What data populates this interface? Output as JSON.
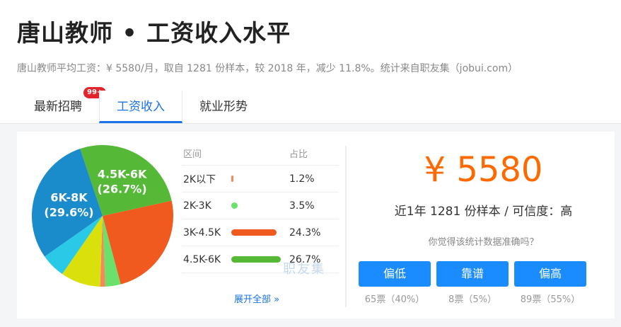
{
  "page": {
    "title": "唐山教师 • 工资收入水平",
    "subtitle": "唐山教师平均工资：¥ 5580/月，取自 1281 份样本，较 2018 年，减少 11.8%。统计来自职友集（jobui.com）"
  },
  "tabs": [
    {
      "label": "最新招聘",
      "badge": "99+"
    },
    {
      "label": "工资收入"
    },
    {
      "label": "就业形势"
    }
  ],
  "chart_data": {
    "type": "pie",
    "slices": [
      {
        "label": "2K以下",
        "value": 1.2,
        "color": "#f28a5c"
      },
      {
        "label": "2K-3K",
        "value": 3.5,
        "color": "#6be06b"
      },
      {
        "label": "3K-4.5K",
        "value": 24.3,
        "color": "#f05a1e"
      },
      {
        "label": "4.5K-6K",
        "value": 26.7,
        "color": "#55b837"
      },
      {
        "label": "6K-8K",
        "value": 29.6,
        "color": "#1a8ccc"
      },
      {
        "value": 5.6,
        "color": "#2ac9e8"
      },
      {
        "value": 9.1,
        "color": "#d9e00b"
      }
    ],
    "annotations": [
      {
        "range": "6K-8K",
        "percent": "(29.6%)"
      },
      {
        "range": "4.5K-6K",
        "percent": "(26.7%)"
      }
    ]
  },
  "table": {
    "header_range": "区间",
    "header_share": "占比",
    "rows": [
      {
        "range": "2K以下",
        "share": "1.2%",
        "color": "#f28a5c",
        "value": 1.2
      },
      {
        "range": "2K-3K",
        "share": "3.5%",
        "color": "#6be06b",
        "value": 3.5
      },
      {
        "range": "3K-4.5K",
        "share": "24.3%",
        "color": "#f05a1e",
        "value": 24.3
      },
      {
        "range": "4.5K-6K",
        "share": "26.7%",
        "color": "#55b837",
        "value": 26.7
      }
    ],
    "expand_label": "展开全部 »"
  },
  "watermark": "职友集",
  "stats": {
    "salary": "¥ 5580",
    "samples": "近1年 1281 份样本 / 可信度：高",
    "question": "你觉得该统计数据准确吗？"
  },
  "votes": [
    {
      "label": "偏低",
      "count": "65票（40%）"
    },
    {
      "label": "靠谱",
      "count": "8票（5%）"
    },
    {
      "label": "偏高",
      "count": "89票（55%）"
    }
  ]
}
